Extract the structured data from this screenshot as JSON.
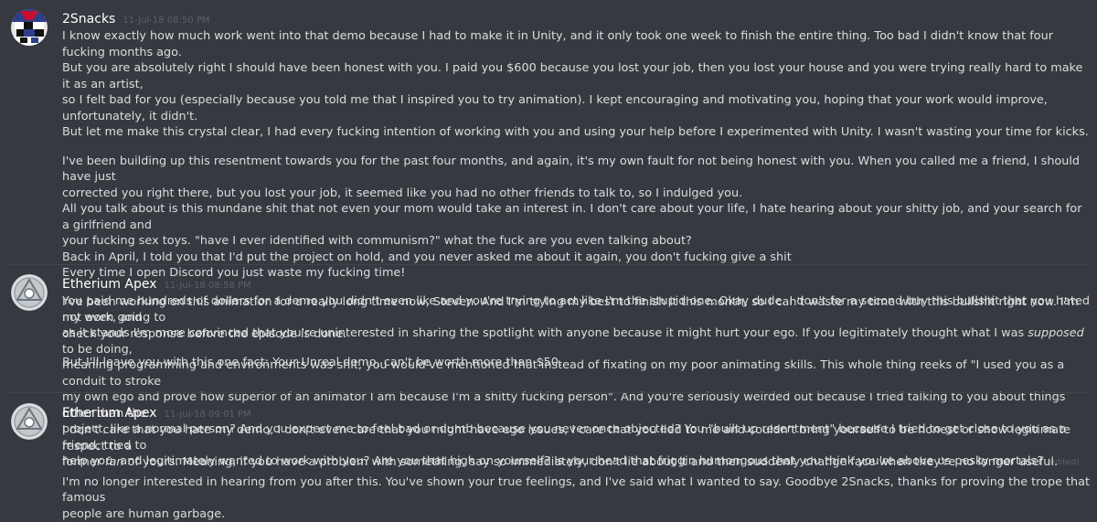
{
  "messages": [
    {
      "username": "2Snacks",
      "timestamp": "11-Jul-18 08:50 PM",
      "lines": [
        "I know exactly how much work went into that demo because I had to make it in Unity, and it only took one week to finish the entire thing. Too bad I didn't know that four fucking months ago.",
        "But you are absolutely right I should have been honest with you. I paid you $600 because you lost your job, then you lost your house and you were trying really hard to make it as an artist,",
        "so I felt bad for you (especially because you told me that I inspired you to try animation). I kept encouraging and motivating you, hoping that your work would improve, unfortunately, it didn't.",
        "But let me make this crystal clear, I had every fucking intention of working with you and using your help before I experimented with Unity. I wasn't wasting your time for kicks.",
        "",
        "I've been building up this resentment towards you for the past four months, and again, it's my own fault for not being honest with you. When you called me a friend, I should have just",
        "corrected you right there, but you lost your job, it seemed like you had no other friends to talk to, so I indulged you.",
        "All you talk about is this mundane shit that not even your mom would take an interest in. I don't care about your life, I hate hearing about your shitty job, and your search for a girlfriend and",
        "your fucking sex toys. \"have I ever identified with communism?\" what the fuck are you even talking about?",
        "Back in April, I told you that I'd put the project on hold, and you never asked me about it again, you don't fucking give a shit",
        "Every time I open Discord you just waste my fucking time!",
        "",
        "I've been working on this animation for a really long time now, Steven. And I'm trying my best to finish it this month, so I can't waste my time with this bullshit right now. I'm not even going to",
        "check your response before the episode is done.",
        "",
        "But I'll leave you with this one fact: Your Unreal demo, can't be worth more than $50."
      ]
    },
    {
      "username": "Etherium Apex",
      "timestamp": "11-Jul-18 08:58 PM",
      "lines_a": [
        "You paid me hundreds of dollars for a demo you didn't even like and you're trying to act like I'm the stupid one. Okay dude. I don't for a second buy this bullshit that you hated my work, and",
        "as it stands I'm more convinced that you're uninterested in sharing the spotlight with anyone because it might hurt your ego. If you legitimately thought what I was "
      ],
      "italic_a": "supposed",
      "after_italic_a": " to be doing,",
      "lines_b": [
        "meaning programming and environments was shit, you would've mentioned that instead of fixating on my poor animating skills. This whole thing reeks of \"I used you as a conduit to stroke",
        "my own ego and prove how superior of an animator I am because I'm a shitty fucking person\". And you're seriously weirded out because I tried talking to you about things other than the",
        "project, like a normal person? And you expect me to feel bad or dumb because you never once objected? You \"built up resentment\" because I tried to get close to you as a friend, tried to",
        "help you, and legitimately wanted to work with you? Are you that high on yourself? Is your head that friggin humongous that you think you're above us pesky mortals?"
      ],
      "edited": "(edited)"
    },
    {
      "username": "Etherium Apex",
      "timestamp": "11-Jul-18 09:01 PM",
      "line1": "I don't care that you hate my demo, I don't even care that you might have ego issues, I care that you lied to me and couldn't bring yourself to be honest or show legitimate respect to a",
      "line2_pre": "former ",
      "line2_italic": "fan",
      "line2_post": " of yours. Meaning, if you have a problem with something, say so immediately, don't lie about it and then suddenly change face when they're no longer useful.",
      "line3": "I'm no longer interested in hearing from you after this. You've shown your true feelings, and I've said what I wanted to say. Goodbye 2Snacks, thanks for proving the trope that famous",
      "line4": "people are human garbage."
    }
  ]
}
